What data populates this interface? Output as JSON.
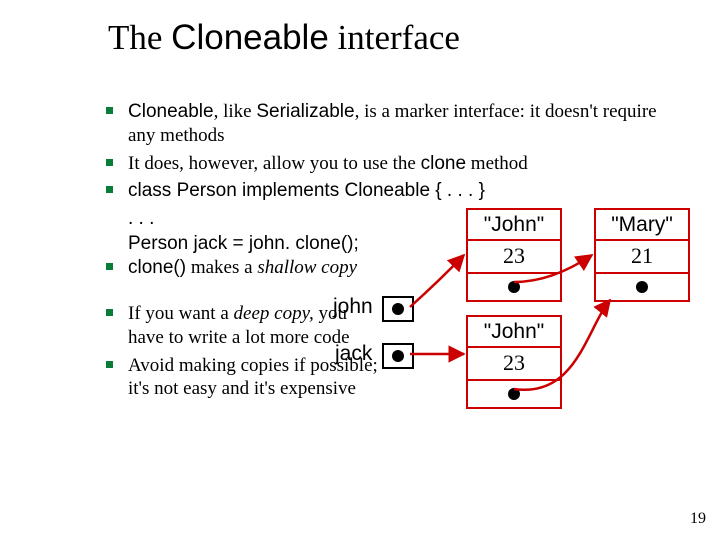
{
  "title": {
    "pre": "The ",
    "code": "Cloneable",
    "post": " interface"
  },
  "bullets": {
    "b1a": "Cloneable",
    "b1b": ", like ",
    "b1c": "Serializable",
    "b1d": ", is a marker interface: it doesn't require any methods",
    "b2a": "It does, however, allow you to use the ",
    "b2b": "clone",
    "b2c": " method",
    "b3": "class Person implements Cloneable { . . . }",
    "code1": ". . .",
    "code2": "Person jack = john. clone();",
    "b4a": "clone()",
    "b4b": " makes a ",
    "b4c": "shallow copy",
    "b5a": "If you want a ",
    "b5b": "deep copy,",
    "b5c": " you have to write a lot more code",
    "b6": "Avoid making copies if possible; it's not easy and it's expensive"
  },
  "diagram": {
    "johnLabel": "john",
    "jackLabel": "jack",
    "person1": {
      "name": "\"John\"",
      "age": "23"
    },
    "person1clone": {
      "name": "\"John\"",
      "age": "23"
    },
    "person2": {
      "name": "\"Mary\"",
      "age": "21"
    }
  },
  "pageNumber": "19"
}
